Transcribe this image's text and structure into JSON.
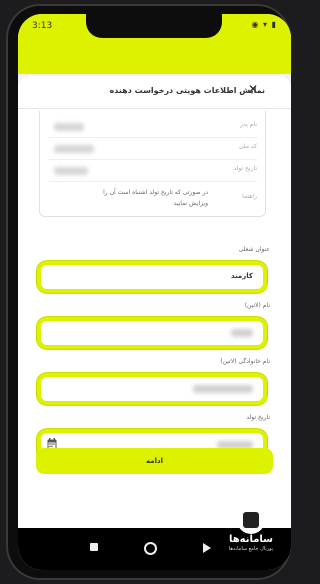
{
  "status_bar": {
    "time": "3:13",
    "icons": "◉ ▾ ▮"
  },
  "sheet": {
    "title": "نمایش اطلاعات هویتی درخواست دهنده",
    "close_glyph": "✕"
  },
  "info": {
    "father_name_label": "نام پدر",
    "national_code_label": "کد ملی",
    "birth_date_label": "تاریخ تولد",
    "hint_label": "راهنما",
    "hint_text": "در صورتی که تاریخ تولد اشتباه است آن را ویرایش نمایید"
  },
  "form": {
    "job_title_label": "عنوان شغلی",
    "job_title_value": "کارمند",
    "latin_name_label": "نام (لاتین)",
    "latin_lastname_label": "نام خانوادگی (لاتین)",
    "birth_date_label": "تاریخ تولد",
    "submit_label": "ادامه"
  },
  "watermark": {
    "title": "سامانه‌ها",
    "subtitle": "پورتال جامع سامانه‌ها"
  },
  "colors": {
    "accent": "#dcf200",
    "background": "#f2f2f2"
  },
  "icons": [
    "close-icon",
    "calendar-icon",
    "wifi-icon",
    "battery-icon",
    "nav-back-icon",
    "nav-home-icon",
    "nav-recent-icon"
  ]
}
